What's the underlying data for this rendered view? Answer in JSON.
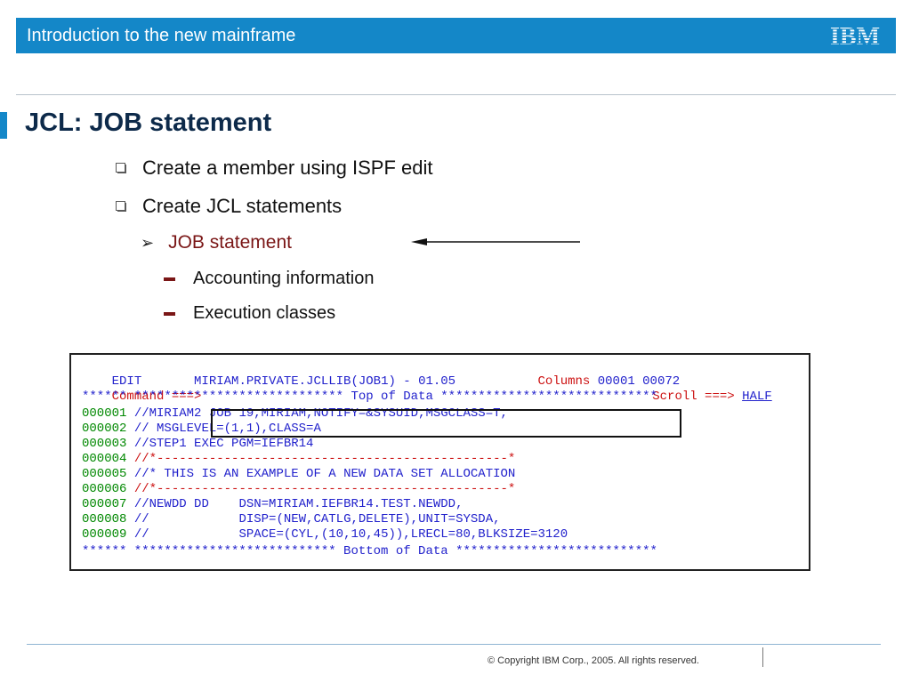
{
  "header": {
    "title": "Introduction to the new mainframe",
    "logo": "IBM"
  },
  "slide": {
    "title": "JCL: JOB statement",
    "bullets": [
      "Create a member using ISPF edit",
      "Create JCL statements"
    ],
    "sub_bullet": "JOB statement",
    "sub_sub_bullets": [
      "Accounting information",
      "Execution classes"
    ]
  },
  "terminal": {
    "edit_label": "EDIT",
    "dataset": "MIRIAM.PRIVATE.JCLLIB(JOB1) - 01.05",
    "columns_label": "Columns",
    "columns_value": "00001 00072",
    "command_label": "Command ===>",
    "command_value": "",
    "scroll_label": "Scroll ===>",
    "scroll_value": "HALF",
    "top_of_data": "****** **************************** Top of Data *****************************",
    "lines": [
      {
        "num": "000001",
        "text": "//MIRIAM2 JOB 19,MIRIAM,NOTIFY=&SYSUID,MSGCLASS=T,"
      },
      {
        "num": "000002",
        "text": "// MSGLEVEL=(1,1),CLASS=A"
      },
      {
        "num": "000003",
        "text": "//STEP1 EXEC PGM=IEFBR14"
      },
      {
        "num": "000004",
        "text": "//*-----------------------------------------------*"
      },
      {
        "num": "000005",
        "text": "//* THIS IS AN EXAMPLE OF A NEW DATA SET ALLOCATION"
      },
      {
        "num": "000006",
        "text": "//*-----------------------------------------------*"
      },
      {
        "num": "000007",
        "text": "//NEWDD DD    DSN=MIRIAM.IEFBR14.TEST.NEWDD,"
      },
      {
        "num": "000008",
        "text": "//            DISP=(NEW,CATLG,DELETE),UNIT=SYSDA,"
      },
      {
        "num": "000009",
        "text": "//            SPACE=(CYL,(10,10,45)),LRECL=80,BLKSIZE=3120"
      }
    ],
    "bottom_of_data": "****** *************************** Bottom of Data ***************************"
  },
  "footer": {
    "copyright": "© Copyright IBM Corp., 2005. All rights reserved."
  },
  "colors": {
    "header_blue": "#1487c8",
    "accent_red": "#7a1616",
    "term_blue": "#2222cc",
    "term_red": "#cc1111",
    "term_green": "#008800"
  },
  "icons": {
    "bullet_l1": "square-bullet-icon",
    "bullet_l2": "arrowhead-bullet-icon",
    "bullet_l3": "dash-bullet-icon",
    "pointer": "left-arrow-icon"
  }
}
